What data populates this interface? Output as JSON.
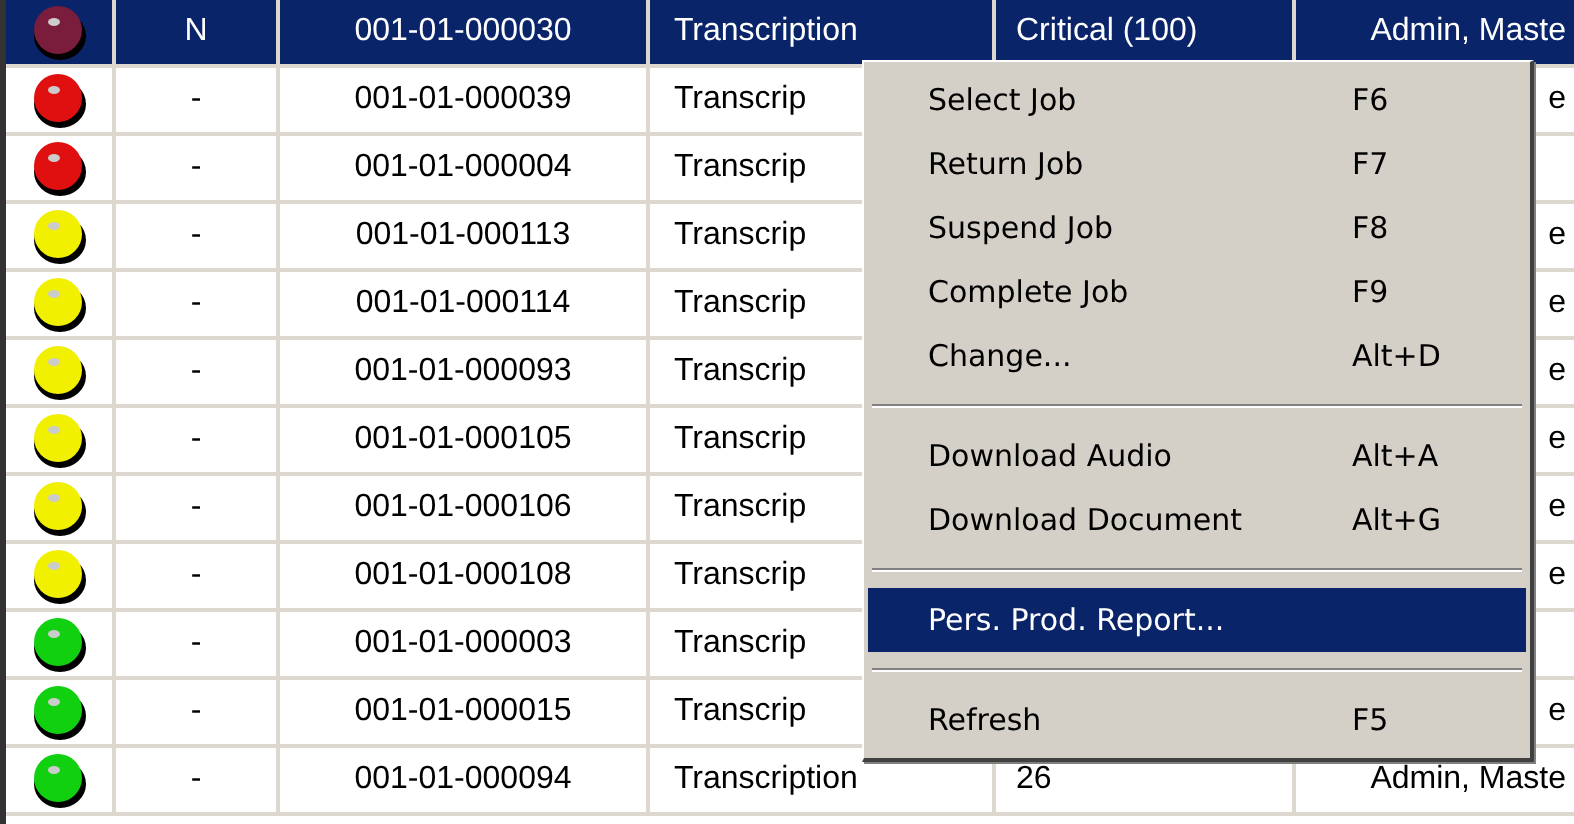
{
  "table": {
    "rows": [
      {
        "color": "#7a1c3c",
        "selected": true,
        "cells": [
          "N",
          "001-01-000030",
          "Transcription",
          "Critical (100)",
          "Admin, Maste"
        ]
      },
      {
        "color": "#e01010",
        "selected": false,
        "cells": [
          "-",
          "001-01-000039",
          "Transcrip",
          null,
          "e"
        ]
      },
      {
        "color": "#e01010",
        "selected": false,
        "cells": [
          "-",
          "001-01-000004",
          "Transcrip",
          null,
          null
        ]
      },
      {
        "color": "#f0f000",
        "selected": false,
        "cells": [
          "-",
          "001-01-000113",
          "Transcrip",
          null,
          "e"
        ]
      },
      {
        "color": "#f0f000",
        "selected": false,
        "cells": [
          "-",
          "001-01-000114",
          "Transcrip",
          null,
          "e"
        ]
      },
      {
        "color": "#f0f000",
        "selected": false,
        "cells": [
          "-",
          "001-01-000093",
          "Transcrip",
          null,
          "e"
        ]
      },
      {
        "color": "#f0f000",
        "selected": false,
        "cells": [
          "-",
          "001-01-000105",
          "Transcrip",
          null,
          "e"
        ]
      },
      {
        "color": "#f0f000",
        "selected": false,
        "cells": [
          "-",
          "001-01-000106",
          "Transcrip",
          null,
          "e"
        ]
      },
      {
        "color": "#f0f000",
        "selected": false,
        "cells": [
          "-",
          "001-01-000108",
          "Transcrip",
          null,
          "e"
        ]
      },
      {
        "color": "#10d010",
        "selected": false,
        "cells": [
          "-",
          "001-01-000003",
          "Transcrip",
          null,
          null
        ]
      },
      {
        "color": "#10d010",
        "selected": false,
        "cells": [
          "-",
          "001-01-000015",
          "Transcrip",
          null,
          "e"
        ]
      },
      {
        "color": "#10d010",
        "selected": false,
        "cells": [
          "-",
          "001-01-000094",
          "Transcription",
          "26",
          "Admin, Maste"
        ]
      }
    ]
  },
  "context_menu": {
    "items": [
      {
        "kind": "item",
        "label": "Select Job",
        "shortcut": "F6",
        "selected": false
      },
      {
        "kind": "item",
        "label": "Return Job",
        "shortcut": "F7",
        "selected": false
      },
      {
        "kind": "item",
        "label": "Suspend Job",
        "shortcut": "F8",
        "selected": false
      },
      {
        "kind": "item",
        "label": "Complete Job",
        "shortcut": "F9",
        "selected": false
      },
      {
        "kind": "item",
        "label": "Change...",
        "shortcut": "Alt+D",
        "selected": false
      },
      {
        "kind": "separator"
      },
      {
        "kind": "item",
        "label": "Download Audio",
        "shortcut": "Alt+A",
        "selected": false
      },
      {
        "kind": "item",
        "label": "Download Document",
        "shortcut": "Alt+G",
        "selected": false
      },
      {
        "kind": "separator"
      },
      {
        "kind": "item",
        "label": "Pers. Prod. Report...",
        "selected": true
      },
      {
        "kind": "separator"
      },
      {
        "kind": "item",
        "label": "Refresh",
        "shortcut": "F5",
        "selected": false
      }
    ]
  }
}
